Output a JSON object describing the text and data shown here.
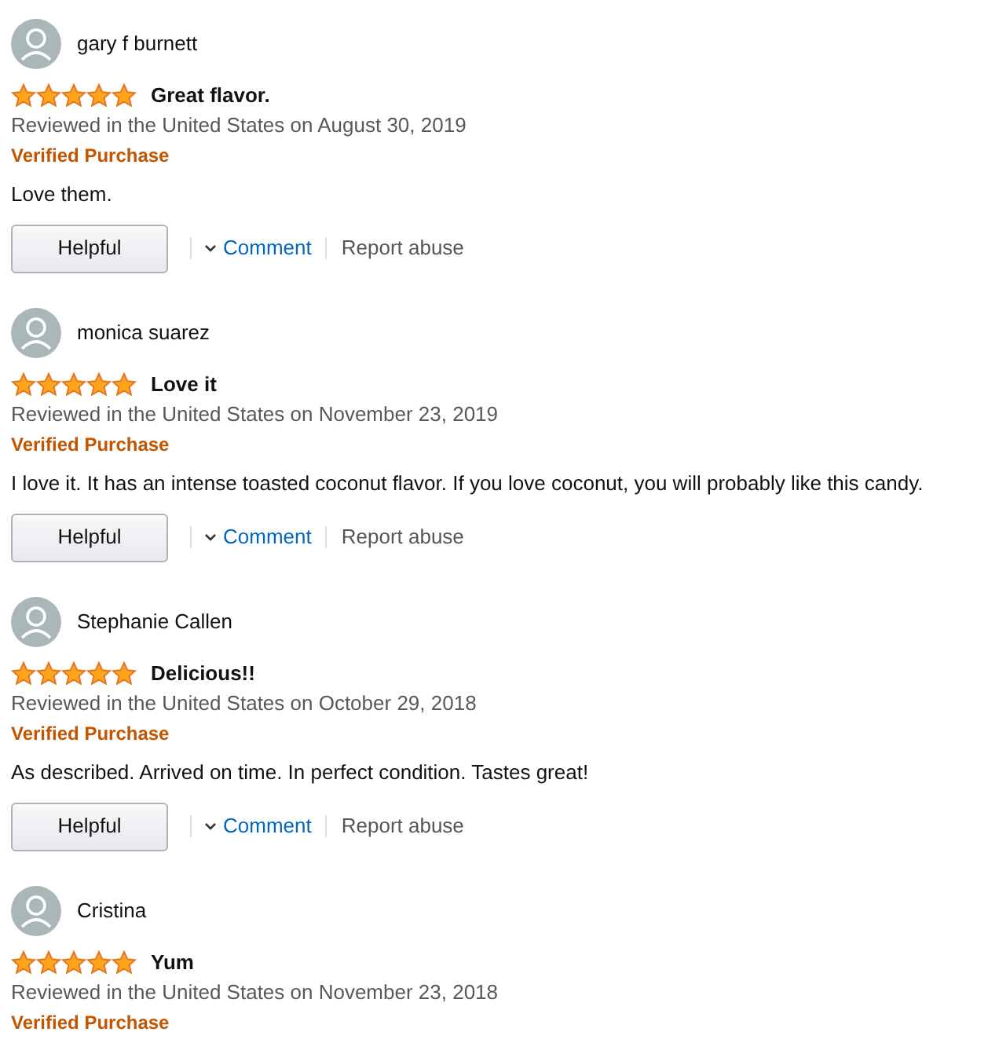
{
  "reviews": [
    {
      "author": "gary f burnett",
      "stars": 5,
      "title": "Great flavor.",
      "date": "Reviewed in the United States on August 30, 2019",
      "badge": "Verified Purchase",
      "body": "Love them.",
      "actions": {
        "helpful": "Helpful",
        "comment": "Comment",
        "report": "Report abuse"
      }
    },
    {
      "author": "monica suarez",
      "stars": 5,
      "title": "Love it",
      "date": "Reviewed in the United States on November 23, 2019",
      "badge": "Verified Purchase",
      "body": "I love it. It has an intense toasted coconut flavor. If you love coconut, you will probably like this candy.",
      "actions": {
        "helpful": "Helpful",
        "comment": "Comment",
        "report": "Report abuse"
      }
    },
    {
      "author": "Stephanie Callen",
      "stars": 5,
      "title": "Delicious!!",
      "date": "Reviewed in the United States on October 29, 2018",
      "badge": "Verified Purchase",
      "body": "As described. Arrived on time. In perfect condition. Tastes great!",
      "actions": {
        "helpful": "Helpful",
        "comment": "Comment",
        "report": "Report abuse"
      }
    },
    {
      "author": "Cristina",
      "stars": 5,
      "title": "Yum",
      "date": "Reviewed in the United States on November 23, 2018",
      "badge": "Verified Purchase"
    }
  ]
}
